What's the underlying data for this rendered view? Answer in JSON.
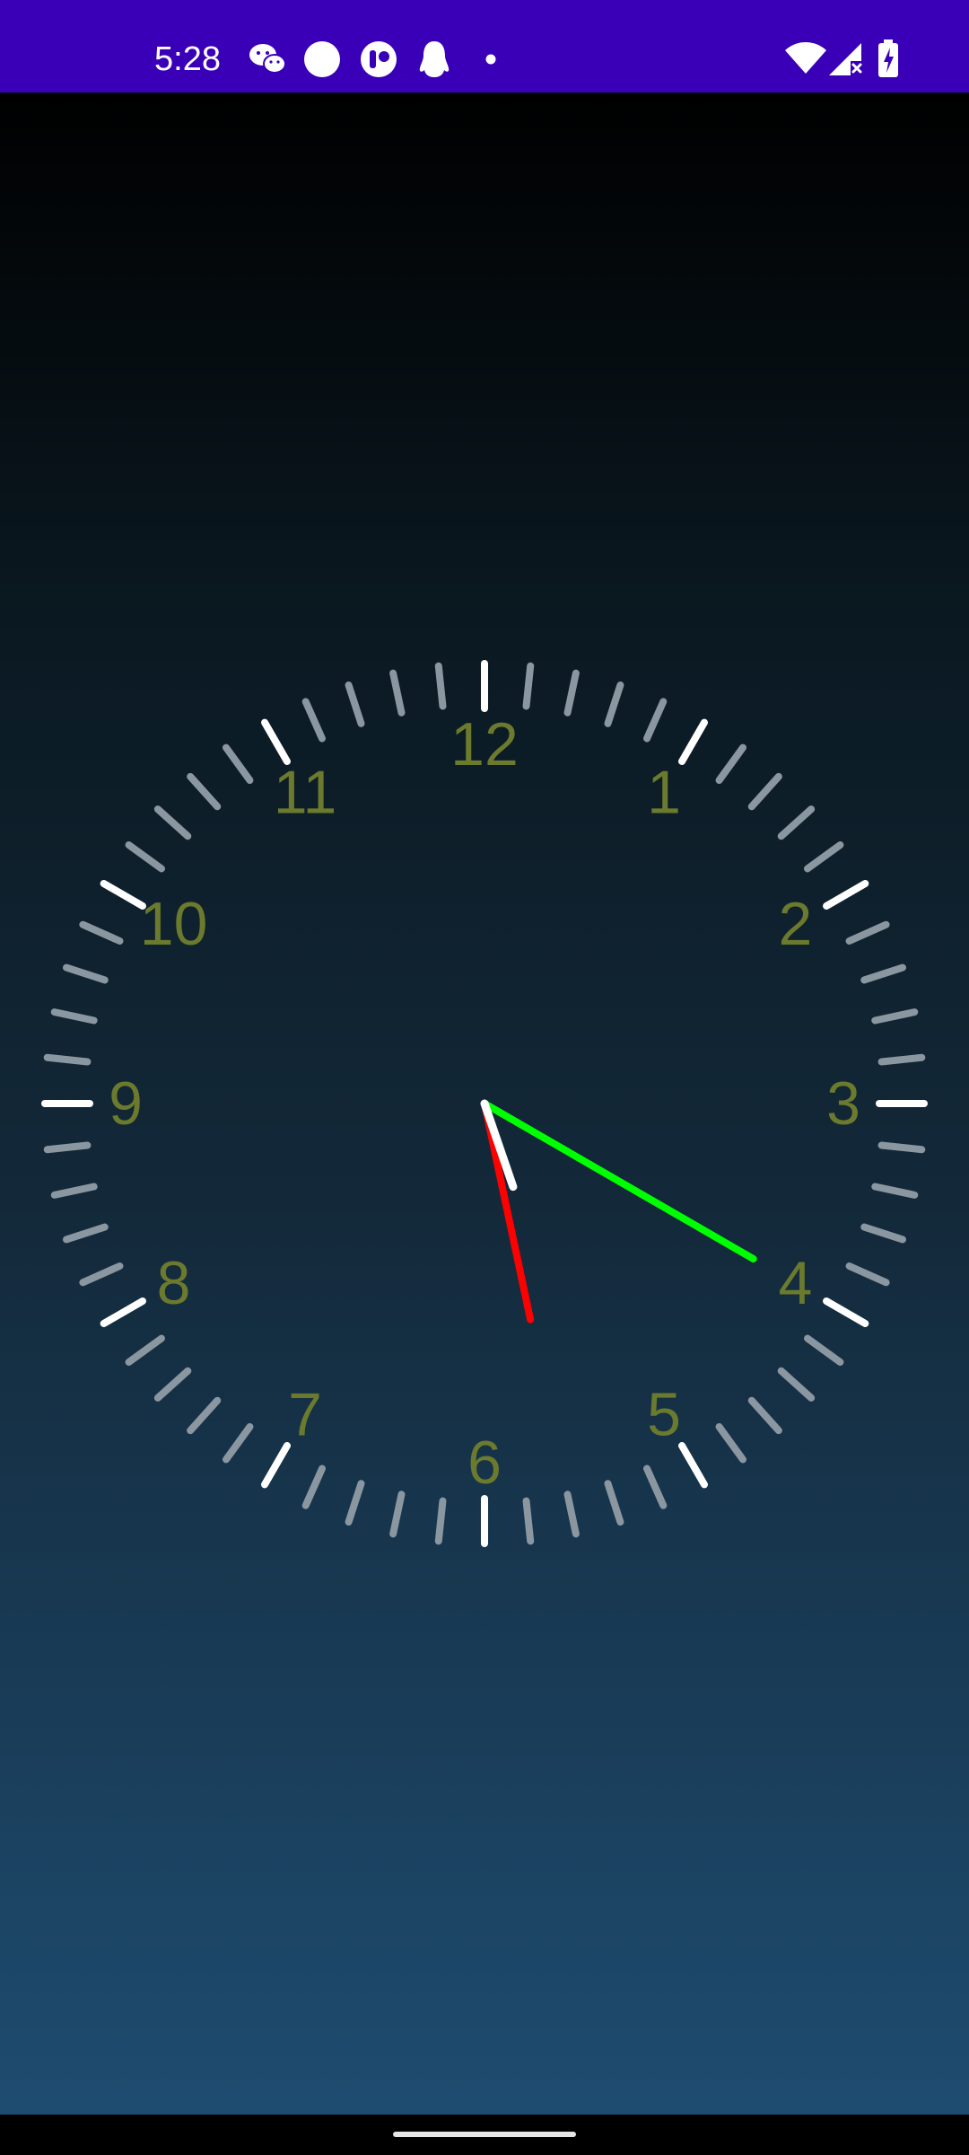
{
  "status_bar": {
    "time": "5:28",
    "background_color": "#3a00b8",
    "notification_icons": [
      "wechat-icon",
      "circle-app-icon",
      "toggle-app-icon",
      "qq-penguin-icon",
      "more-notifications-dot-icon"
    ],
    "system_icons": [
      "wifi-icon",
      "cellular-no-signal-icon",
      "battery-charging-icon"
    ]
  },
  "clock": {
    "numbers": [
      "12",
      "1",
      "2",
      "3",
      "4",
      "5",
      "6",
      "7",
      "8",
      "9",
      "10",
      "11"
    ],
    "colors": {
      "number": "#6b7a2d",
      "major_tick": "#ffffff",
      "minor_tick": "#8a96a0",
      "hour_hand": "#ffffff",
      "minute_hand": "#ff0000",
      "second_hand": "#00ff00"
    }
  },
  "nav_bar": {
    "handle": "gesture-handle"
  }
}
